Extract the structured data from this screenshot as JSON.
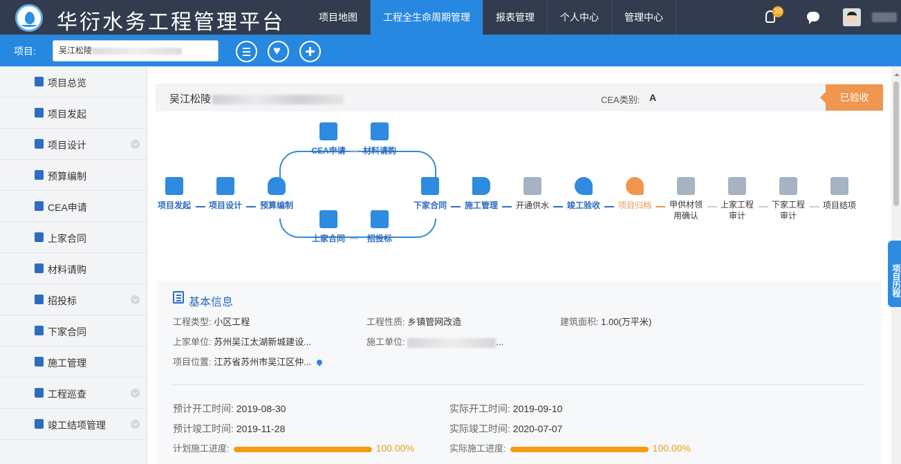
{
  "app": {
    "title": "华衍水务工程管理平台"
  },
  "nav": [
    {
      "label": "项目地图"
    },
    {
      "label": "工程全生命周期管理",
      "active": true
    },
    {
      "label": "报表管理"
    },
    {
      "label": "个人中心"
    },
    {
      "label": "管理中心"
    }
  ],
  "header": {
    "notification_count": "10"
  },
  "project_bar": {
    "label": "项目:",
    "value": "吴江松陵"
  },
  "sidebar": [
    {
      "label": "项目总览",
      "chevron": false
    },
    {
      "label": "项目发起",
      "chevron": false
    },
    {
      "label": "项目设计",
      "chevron": true
    },
    {
      "label": "预算编制",
      "chevron": false
    },
    {
      "label": "CEA申请",
      "chevron": false
    },
    {
      "label": "上家合同",
      "chevron": false
    },
    {
      "label": "材料请购",
      "chevron": false
    },
    {
      "label": "招投标",
      "chevron": true
    },
    {
      "label": "下家合同",
      "chevron": false
    },
    {
      "label": "施工管理",
      "chevron": false
    },
    {
      "label": "工程巡查",
      "chevron": true
    },
    {
      "label": "竣工结项管理",
      "chevron": true
    }
  ],
  "project": {
    "name": "吴江松陵",
    "cea_label": "CEA类别:",
    "cea_value": "A",
    "status": "已验收"
  },
  "workflow": {
    "project_start": "项目发起",
    "project_design": "项目设计",
    "budget": "预算编制",
    "cea": "CEA申请",
    "material": "材料请购",
    "upper_contract": "上家合同",
    "bidding": "招投标",
    "lower_contract": "下家合同",
    "construction": "施工管理",
    "water_supply": "开通供水",
    "acceptance": "竣工验收",
    "archive": "项目归档",
    "supplied_material_1": "甲供材领",
    "supplied_material_2": "用确认",
    "upper_audit_1": "上家工程",
    "upper_audit_2": "审计",
    "lower_audit_1": "下家工程",
    "lower_audit_2": "审计",
    "closing": "项目结项"
  },
  "basic_info": {
    "title": "基本信息",
    "eng_type_label": "工程类型:",
    "eng_type": "小区工程",
    "eng_nature_label": "工程性质:",
    "eng_nature": "乡镇管网改造",
    "area_label": "建筑面积:",
    "area": "1.00(万平米)",
    "upper_unit_label": "上家单位:",
    "upper_unit": "苏州吴江太湖新城建设...",
    "builder_label": "施工单位:",
    "builder_suffix": "...",
    "location_label": "项目位置:",
    "location": "江苏省苏州市吴江区仲...",
    "plan_start_label": "预计开工时间:",
    "plan_start": "2019-08-30",
    "actual_start_label": "实际开工时间:",
    "actual_start": "2019-09-10",
    "plan_end_label": "预计竣工时间:",
    "plan_end": "2019-11-28",
    "actual_end_label": "实际竣工时间:",
    "actual_end": "2020-07-07",
    "plan_progress_label": "计划施工进度:",
    "plan_progress": "100.00%",
    "plan_progress_fraction": 1.0,
    "actual_progress_label": "实际施工进度:",
    "actual_progress": "100.00%",
    "actual_progress_fraction": 1.0
  },
  "history_tab": "项目历程"
}
